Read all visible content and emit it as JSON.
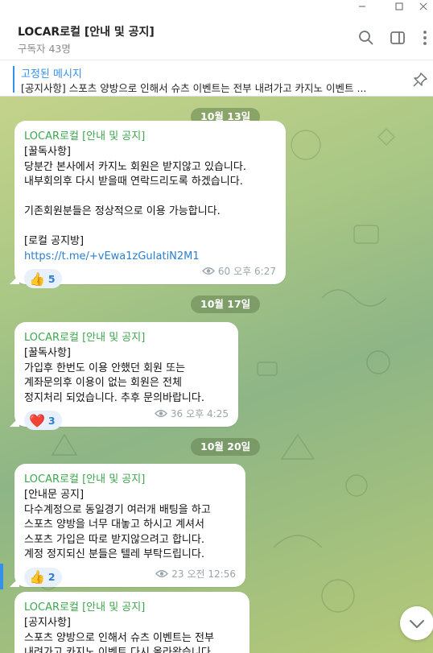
{
  "header": {
    "title": "LOCAR로컬 [안내 및 공지]",
    "subtitle": "구독자 43명",
    "icons": [
      "search-icon",
      "sidebar-toggle-icon",
      "more-vertical-icon"
    ]
  },
  "window_controls": [
    "minimize-icon",
    "maximize-icon",
    "close-icon"
  ],
  "pinned": {
    "title": "고정된 메시지",
    "text": "[공지사항] 스포츠 양방으로 인해서 슈츠 이벤트는 전부 내려가고 카지노 이벤트 ..."
  },
  "messages": [
    {
      "date": "10월 13일",
      "sender": "LOCAR로컬 [안내 및 공지]",
      "body": "[꿀독사항]\n당분간 본사에서 카지노 회원은 받지않고 있습니다.\n내부회의후 다시 받을때 연락드리도록 하겠습니다.\n\n기존회원분들은 정상적으로 이용 가능합니다.\n\n[로컬 공지방]",
      "link": "https://t.me/+vEwa1zGuIatiN2M1",
      "reaction": {
        "emoji": "👍",
        "count": "5"
      },
      "views": "60",
      "time": "오후 6:27"
    },
    {
      "date": "10월 17일",
      "sender": "LOCAR로컬 [안내 및 공지]",
      "body": "[꿀독사항]\n가입후 한번도 이용 안했던 회원 또는\n계좌문의후 이용이 없는 회원은 전체\n정지처리 되었습니다. 추후 문의바랍니다.",
      "link": "",
      "reaction": {
        "emoji": "❤️",
        "count": "3"
      },
      "views": "36",
      "time": "오후 4:25"
    },
    {
      "date": "10월 20일",
      "sender": "LOCAR로컬 [안내 및 공지]",
      "body": "[안내문 공지]\n다수계정으로 동일경기 여러개 배팅을 하고\n스포츠 양방을 너무 대놓고 하시고 계셔서\n스포츠 가입은 따로 받지않으려고 합니다.\n계정 정지되신 분들은 텔레 부탁드립니다.",
      "link": "",
      "reaction": {
        "emoji": "👍",
        "count": "2"
      },
      "views": "23",
      "time": "오전 12:56"
    },
    {
      "date": "",
      "sender": "LOCAR로컬 [안내 및 공지]",
      "body": "[공지사항]\n스포츠 양방으로 인해서 슈츠 이벤트는 전부\n내려가고 카지노 이벤트 다시 올라왔습니다.",
      "link": "",
      "reaction": null,
      "views": "",
      "time": ""
    }
  ],
  "colors": {
    "accent": "#3390ec",
    "sender": "#3ea74e",
    "link": "#2a7fd0"
  }
}
